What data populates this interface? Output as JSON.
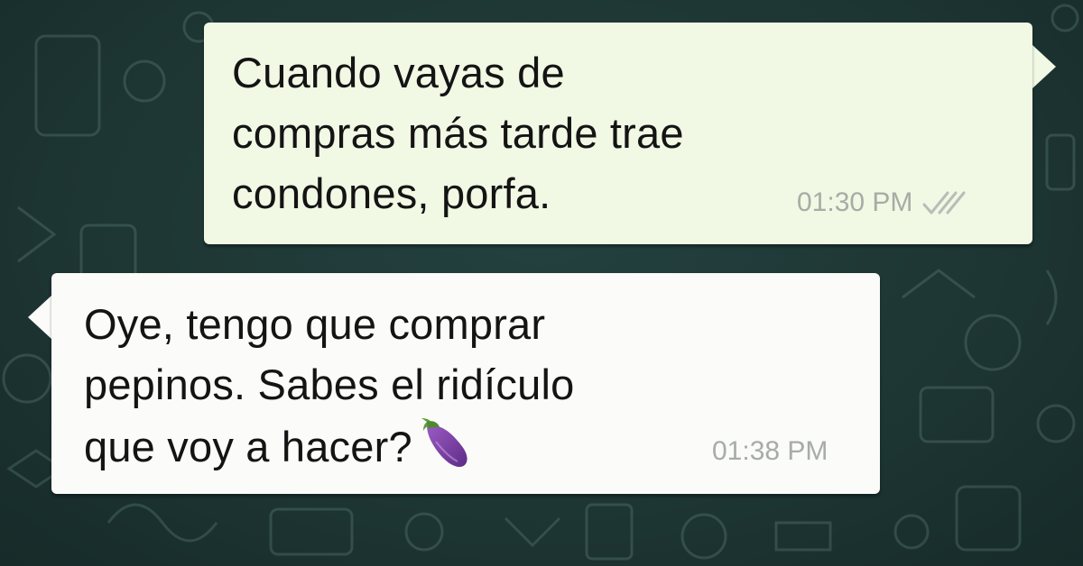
{
  "conversation": {
    "messages": [
      {
        "direction": "outgoing",
        "text": "Cuando vayas de\ncompras más tarde trae\ncondones, porfa.",
        "time": "01:30 PM",
        "status_icon": "double-check-icon"
      },
      {
        "direction": "incoming",
        "text": "Oye, tengo que comprar\npepinos. Sabes el ridículo\nque voy a hacer?",
        "emoji": "eggplant-emoji",
        "time": "01:38 PM"
      }
    ]
  },
  "colors": {
    "chat_background": "#1f3a38",
    "outgoing_bubble": "#f1f8e4",
    "incoming_bubble": "#fbfbf9",
    "timestamp": "#a7aca6"
  }
}
